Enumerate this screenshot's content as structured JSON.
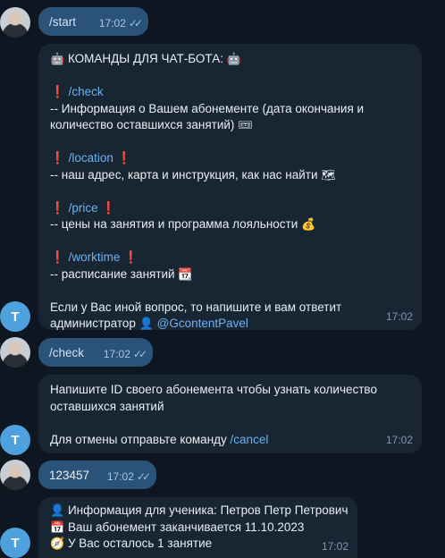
{
  "messages": [
    {
      "text": "/start",
      "time": "17:02"
    },
    {
      "header": "КОМАНДЫ ДЛЯ ЧАТ-БОТА:",
      "sections": [
        {
          "cmd": "/check",
          "desc_1": "-- Информация о Вашем абонементе (дата окончания и",
          "desc_2": "количество оставшихся занятий)"
        },
        {
          "cmd": "/location",
          "desc_1": "-- наш адрес, карта и инструкция, как нас найти"
        },
        {
          "cmd": "/price",
          "desc_1": "-- цены на занятия и программа лояльности"
        },
        {
          "cmd": "/worktime",
          "desc_1": "-- расписание занятий"
        }
      ],
      "footer_1": "Если у Вас иной вопрос, то напишите и вам ответит",
      "footer_2": "администратор",
      "mention": "@GcontentPavel",
      "time": "17:02"
    },
    {
      "text": "/check",
      "time": "17:02"
    },
    {
      "line_1": "Напишите ID своего абонемента чтобы узнать количество",
      "line_2": "оставшихся занятий",
      "line_3": "Для отмены отправьте команду",
      "cmd": "/cancel",
      "time": "17:02"
    },
    {
      "text": "123457",
      "time": "17:02"
    },
    {
      "line_1": "Информация для ученика: Петров Петр Петрович",
      "line_2": "Ваш абонемент заканчивается 11.10.2023",
      "line_3": "У Вас осталось 1 занятие",
      "time": "17:02"
    }
  ],
  "bot_avatar_letter": "T",
  "colors": {
    "background": "#0e1621",
    "incoming": "#182533",
    "outgoing": "#2b5278",
    "link": "#6ab2f2"
  }
}
